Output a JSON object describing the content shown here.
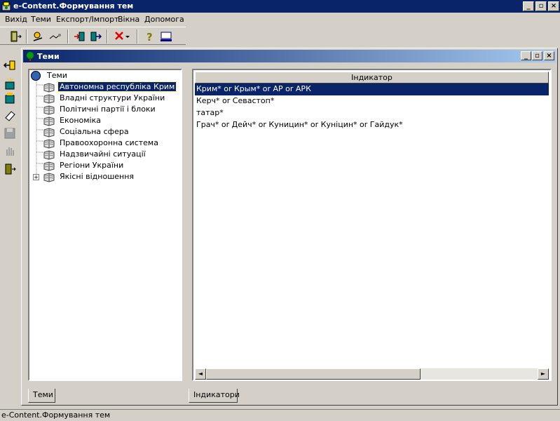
{
  "window": {
    "title": "e-Content.Формування тем"
  },
  "menu": {
    "items": [
      "Вихід",
      "Теми",
      "Експорт/Імпорт",
      "Вікна",
      "Допомога"
    ]
  },
  "mdi": {
    "title": "Теми"
  },
  "tree": {
    "root": "Теми",
    "items": [
      "Автономна республіка Крим",
      "Владні структури України",
      "Політичні партії і блоки",
      "Економіка",
      "Соціальна сфера",
      "Правоохоронна система",
      "Надзвичайні ситуації",
      "Регіони України",
      "Якісні відношення"
    ],
    "selected_index": 0,
    "expand_symbol": "+"
  },
  "indicators": {
    "header": "Індикатор",
    "rows": [
      "Крим* or Крым* or АР or АРК",
      "Керч* or Севастоп*",
      "татар*",
      "Грач*  or Дейч* or Куницин* or Куніцин* or Гайдук*"
    ],
    "selected_index": 0
  },
  "tabs": {
    "left": "Теми",
    "right": "Індикатори"
  },
  "status": {
    "text": "e-Content.Формування тем"
  },
  "colors": {
    "selection": "#0a246a",
    "titlebar": "#0a246a",
    "face": "#d4d0c8"
  }
}
